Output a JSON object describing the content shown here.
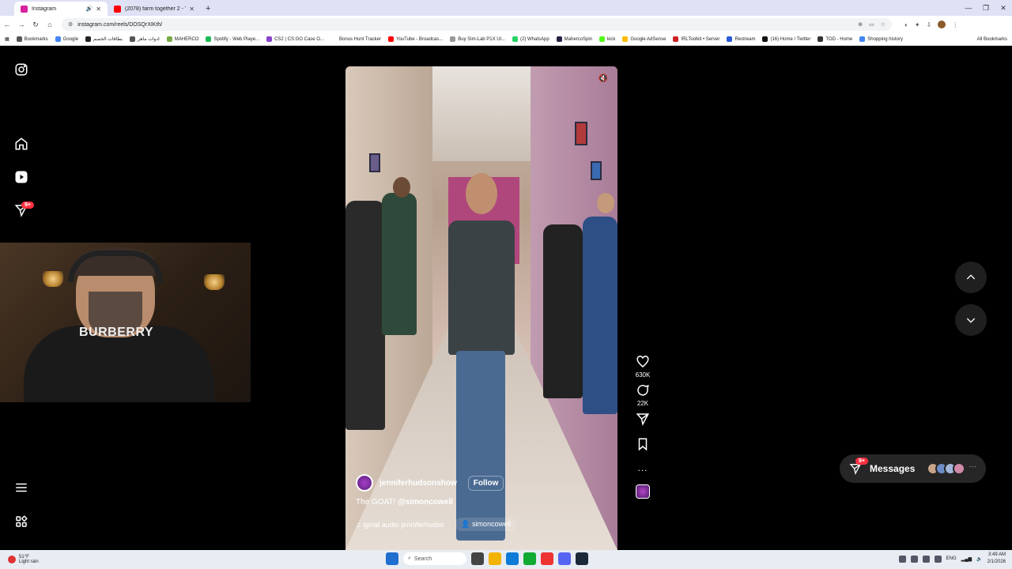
{
  "browser": {
    "tabs": [
      {
        "title": "Instagram",
        "favicon_color": "#d6249f",
        "active": true
      },
      {
        "title": "(2078) farm together 2 - YouTu...",
        "favicon_color": "#ff0000",
        "active": false
      }
    ],
    "new_tab": "+",
    "url": "instagram.com/reels/DOSQrXIKth/",
    "bookmarks": [
      {
        "label": "Bookmarks",
        "color": "#555"
      },
      {
        "label": "Google",
        "color": "#4285f4"
      },
      {
        "label": "بطاقات الخصم",
        "color": "#222"
      },
      {
        "label": "ادوات ماهر",
        "color": "#555"
      },
      {
        "label": "MAHERCO",
        "color": "#7a4"
      },
      {
        "label": "Spotify - Web Playe...",
        "color": "#1db954"
      },
      {
        "label": "CS2 | CS:GO Case O...",
        "color": "#8844cc"
      },
      {
        "label": "Bonus Hunt Tracker",
        "color": "#fff"
      },
      {
        "label": "YouTube - Broadcas...",
        "color": "#ff0000"
      },
      {
        "label": "Buy Sim-Lab P1X Ul...",
        "color": "#999"
      },
      {
        "label": "(2) WhatsApp",
        "color": "#25d366"
      },
      {
        "label": "MahercoSpin",
        "color": "#224"
      },
      {
        "label": "kick",
        "color": "#53fc18"
      },
      {
        "label": "Google AdSense",
        "color": "#fbbc04"
      },
      {
        "label": "IRLToolkit • Server",
        "color": "#c22"
      },
      {
        "label": "Restream",
        "color": "#2a5bd7"
      },
      {
        "label": "(16) Home / Twitter",
        "color": "#111"
      },
      {
        "label": "TOD - Home",
        "color": "#333"
      },
      {
        "label": "Shopping history",
        "color": "#4285f4"
      }
    ],
    "all_bookmarks": "All Bookmarks"
  },
  "sidebar": {
    "notification_badge": "9+"
  },
  "webcam": {
    "shirt_text": "BURBERRY"
  },
  "reel": {
    "author": "jenniferhudsonshow",
    "follow_label": "Follow",
    "caption_prefix": "The GOAT!",
    "caption_mention": "@simoncowell",
    "audio_label": "iginal audio  jenniferhudso",
    "tagged_user": "simoncowell"
  },
  "actions": {
    "likes": "630K",
    "comments": "22K",
    "more": "..."
  },
  "messages": {
    "label": "Messages",
    "badge": "9+",
    "avatar_colors": [
      "#c9a58a",
      "#6b8cc7",
      "#a3b6d9",
      "#d08aa8"
    ],
    "more": "···"
  },
  "taskbar": {
    "temperature": "51°F",
    "weather": "Light rain",
    "search_label": "Search",
    "lang": "ENG",
    "time": "3:49 AM",
    "date": "2/1/2026",
    "apps": [
      "#1f6fd0",
      "#444",
      "#2b7de9",
      "#f2b200",
      "#0f7bd8",
      "#1a3",
      "#e33",
      "#5865f2",
      "#1b2838"
    ]
  }
}
